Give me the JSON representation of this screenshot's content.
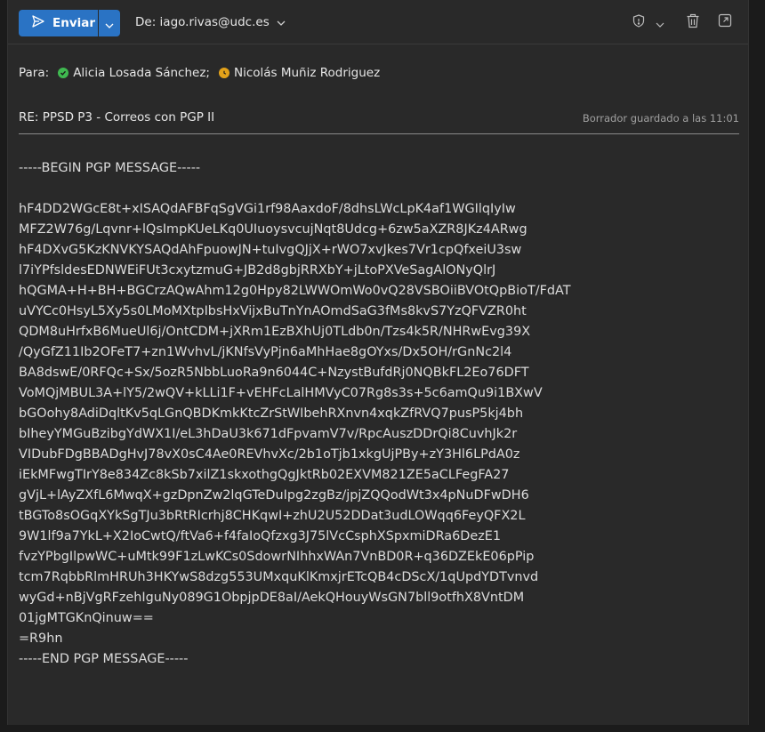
{
  "toolbar": {
    "send_label": "Enviar",
    "from_label": "De: iago.rivas@udc.es",
    "icons": [
      "send-icon",
      "chevron-down-icon",
      "shield-icon",
      "trash-icon",
      "popout-icon"
    ],
    "accent": "#2a73c4"
  },
  "recipients": {
    "to_label": "Para:",
    "items": [
      {
        "name": "Alicia Losada Sánchez;",
        "status": "available",
        "color": "#3fb950"
      },
      {
        "name": "Nicolás Muñiz Rodriguez",
        "status": "away",
        "color": "#e3a21a"
      }
    ]
  },
  "subject": {
    "text": "RE: PPSD P3 - Correos con PGP II",
    "saved_status": "Borrador guardado a las 11:01"
  },
  "body": {
    "lines": [
      "-----BEGIN PGP MESSAGE-----",
      "",
      "hF4DD2WGcE8t+xISAQdAFBFqSgVGi1rf98AaxdoF/8dhsLWcLpK4af1WGIlqIyIw",
      "MFZ2W76g/Lqvnr+lQsImpKUeLKq0UIuoysvcujNqt8Udcg+6zw5aXZR8JKz4ARwg",
      "hF4DXvG5KzKNVKYSAQdAhFpuowJN+tuIvgQJjX+rWO7xvJkes7Vr1cpQfxeiU3sw",
      "l7iYPfsldesEDNWEiFUt3cxytzmuG+JB2d8gbjRRXbY+jLtoPXVeSagAlONyQlrJ",
      "hQGMA+H+BH+BGCrzAQwAhm12g0Hpy82LWWOmWo0vQ28VSBOiiBVOtQpBioT/FdAT",
      "uVYCc0HsyL5Xy5s0LMoMXtpIbsHxVijxBuTnYnAOmdSaG3fMs8kvS7YzQFVZR0ht",
      "QDM8uHrfxB6MueUl6j/OntCDM+jXRm1EzBXhUj0TLdb0n/Tzs4k5R/NHRwEvg39X",
      "/QyGfZ11Ib2OFeT7+zn1WvhvL/jKNfsVyPjn6aMhHae8gOYxs/Dx5OH/rGnNc2l4",
      "BA8dswE/0RFQc+Sx/5ozR5NbbLuoRa9n6044C+NzystBufdRj0NQBkFL2Eo76DFT",
      "VoMQjMBUL3A+lY5/2wQV+kLLi1F+vEHFcLalHMVyC07Rg8s3s+5c6amQu9i1BXwV",
      "bGOohy8AdiDqltKv5qLGnQBDKmkKtcZrStWIbehRXnvn4xqkZfRVQ7pusP5kj4bh",
      "bIheyYMGuBzibgYdWX1I/eL3hDaU3k671dFpvamV7v/RpcAuszDDrQi8CuvhJk2r",
      "VIDubFDgBBADgHvJ78vX0sC4Ae0REVhvXc/2b1oTjb1xkgUjPBy+zY3Hl6LPdA0z",
      "iEkMFwgTIrY8e834Zc8kSb7xilZ1skxothgQgJktRb02EXVM821ZE5aCLFegFA27",
      "gVjL+lAyZXfL6MwqX+gzDpnZw2lqGTeDuIpg2zgBz/jpjZQQodWt3x4pNuDFwDH6",
      "tBGTo8sOGqXYkSgTJu3bRtRIcrhj8CHKqwI+zhU2U52DDat3udLOWqq6FeyQFX2L",
      "9W1lf9a7YkL+X2IoCwtQ/ftVa6+f4faIoQfzxg3J75lVcCsphXSpxmiDRa6DezE1",
      "fvzYPbgIlpwWC+uMtk99F1zLwKCs0SdowrNIhhxWAn7VnBD0R+q36DZEkE06pPip",
      "tcm7RqbbRlmHRUh3HKYwS8dzg553UMxquKlKmxjrETcQB4cDScX/1qUpdYDTvnvd",
      "wyGd+nBjVgRFzehIguNy089G1ObpjpDE8aI/AekQHouyWsGN7bll9otfhX8VntDM",
      "01jgMTGKnQinuw==",
      "=R9hn",
      "-----END PGP MESSAGE-----"
    ]
  }
}
